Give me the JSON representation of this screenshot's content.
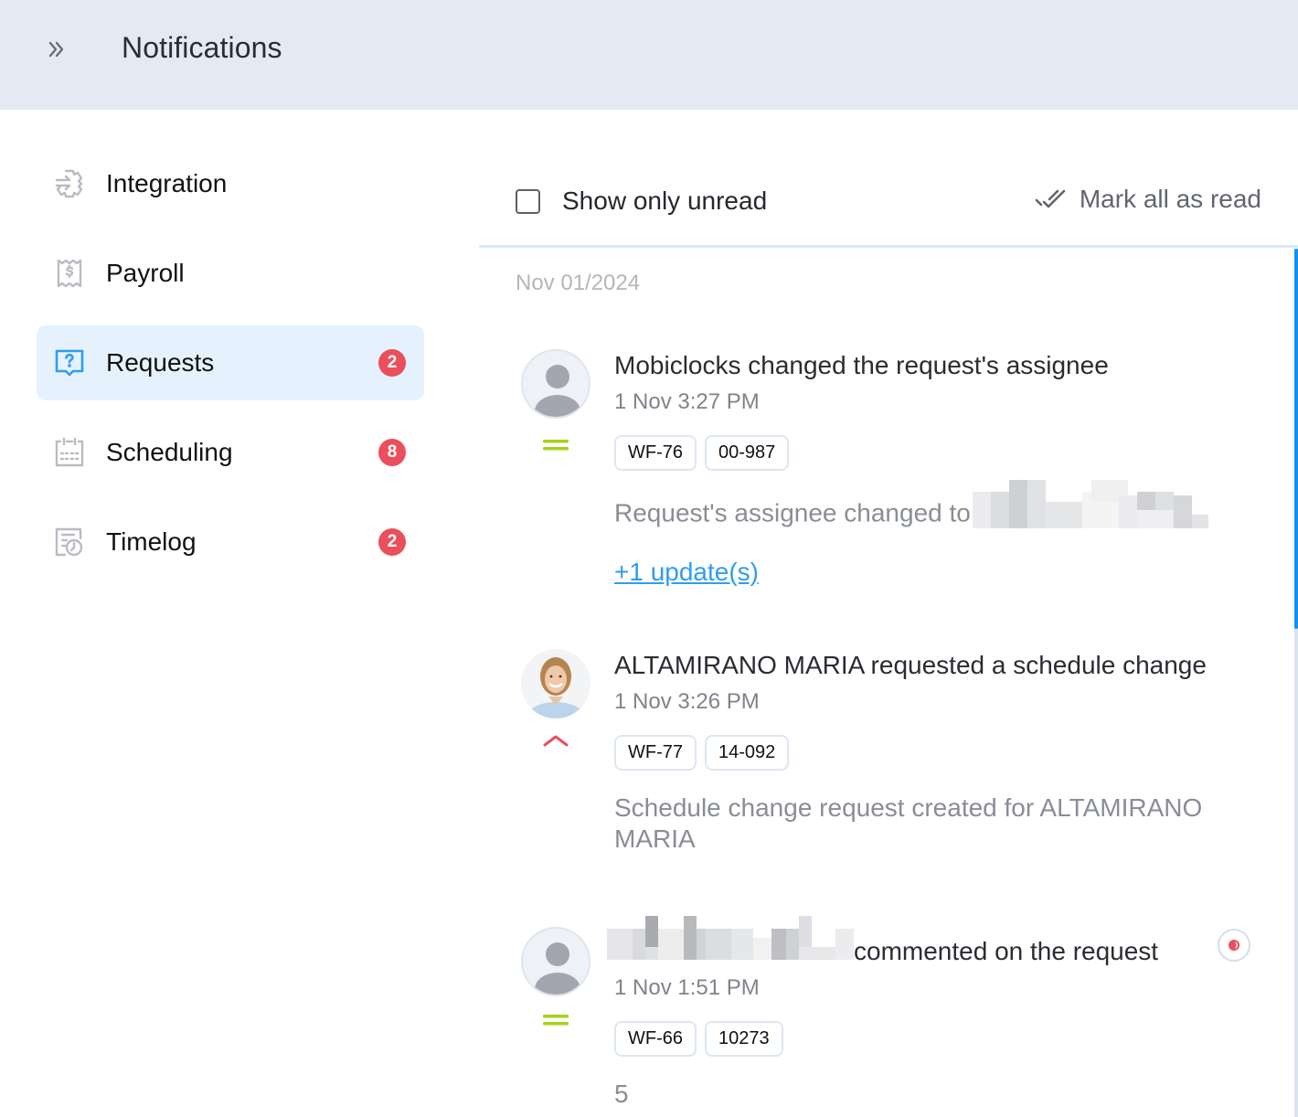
{
  "header": {
    "title": "Notifications",
    "expand_icon": "double-chevron-right-icon"
  },
  "sidebar": {
    "items": [
      {
        "label": "Integration",
        "icon": "integration-gear-icon",
        "badge": null,
        "active": false
      },
      {
        "label": "Payroll",
        "icon": "payroll-receipt-icon",
        "badge": null,
        "active": false
      },
      {
        "label": "Requests",
        "icon": "request-question-icon",
        "badge": "2",
        "active": true
      },
      {
        "label": "Scheduling",
        "icon": "calendar-icon",
        "badge": "8",
        "active": false
      },
      {
        "label": "Timelog",
        "icon": "timelog-clock-icon",
        "badge": "2",
        "active": false
      }
    ]
  },
  "toolbar": {
    "show_only_unread_label": "Show only unread",
    "show_only_unread_checked": false,
    "mark_all_read_label": "Mark all as read"
  },
  "colors": {
    "accent": "#1192f0",
    "badge": "#ea4f5b",
    "priority_medium": "#a6d217",
    "priority_high": "#ea4f5b",
    "header_bg": "#e3eaf3",
    "active_nav_bg": "#e5f2fd"
  },
  "list": {
    "date_header": "Nov 01/2024",
    "notifications": [
      {
        "title": "Mobiclocks changed the request's assignee",
        "time": "1 Nov 3:27 PM",
        "tags": [
          "WF-76",
          "00-987"
        ],
        "description": "Request's assignee changed to",
        "description_redacted": true,
        "link": "+1 update(s)",
        "priority": "medium",
        "avatar": "default-user",
        "unread": false
      },
      {
        "title": "ALTAMIRANO MARIA requested a schedule change",
        "time": "1 Nov 3:26 PM",
        "tags": [
          "WF-77",
          "14-092"
        ],
        "description": "Schedule change request created for ALTAMIRANO MARIA",
        "priority": "high",
        "avatar": "photo",
        "unread": false
      },
      {
        "title": "commented on the request",
        "title_prefix_redacted": true,
        "time": "1 Nov 1:51 PM",
        "tags": [
          "WF-66",
          "10273"
        ],
        "description": "5",
        "priority": "medium",
        "avatar": "default-user",
        "unread": true
      }
    ]
  }
}
